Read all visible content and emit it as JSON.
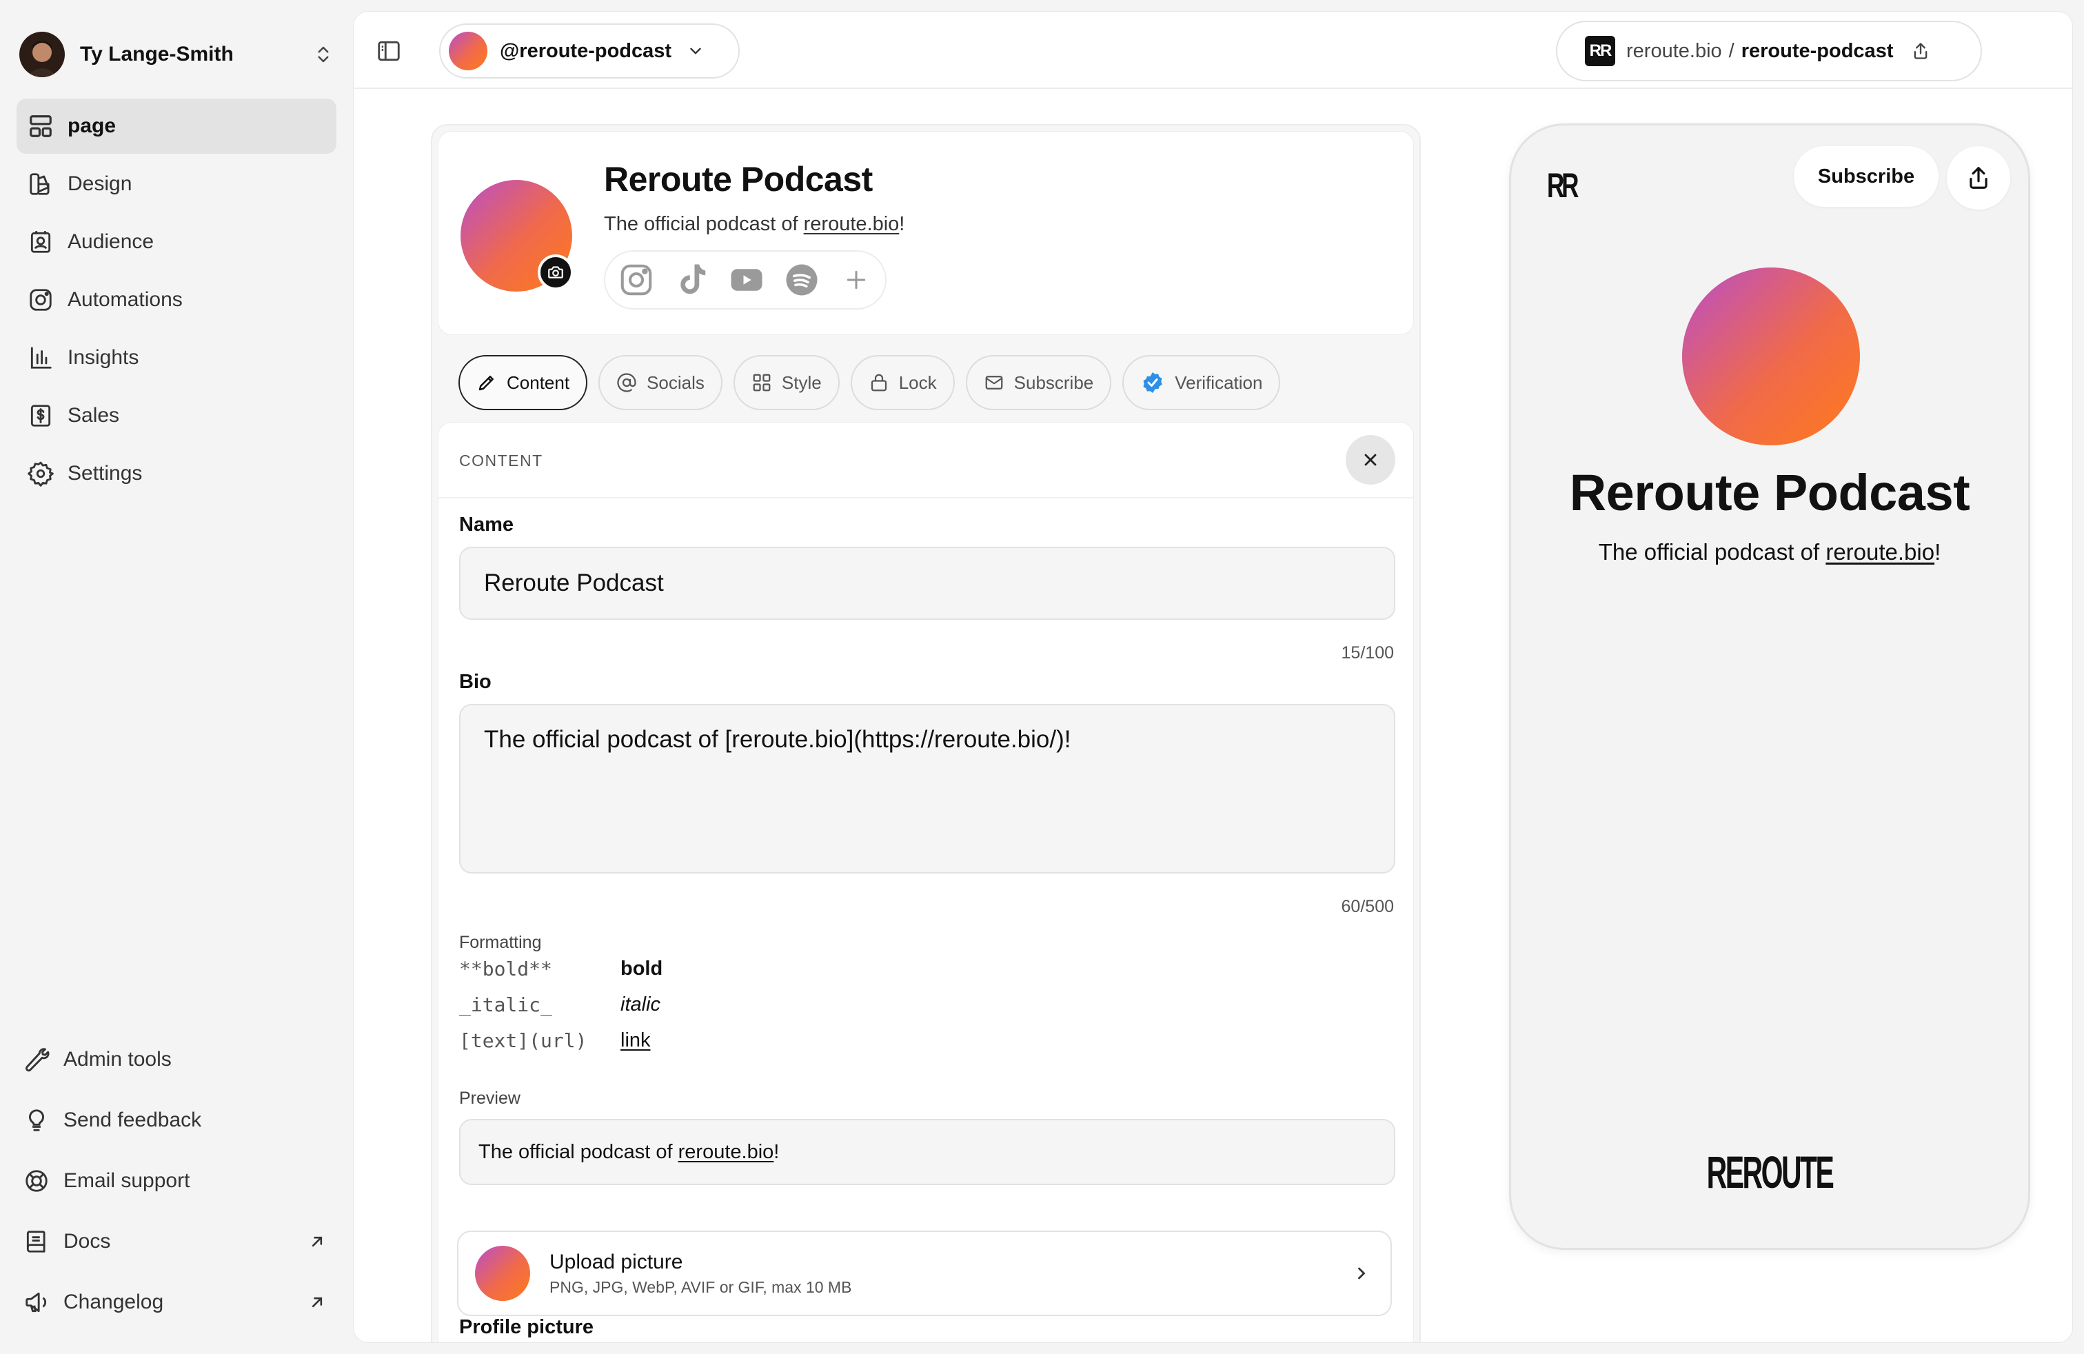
{
  "sidebar": {
    "user_name": "Ty Lange-Smith",
    "nav": [
      {
        "label": "page",
        "icon": "layout-icon",
        "active": true
      },
      {
        "label": "Design",
        "icon": "palette-icon"
      },
      {
        "label": "Audience",
        "icon": "contact-icon"
      },
      {
        "label": "Automations",
        "icon": "instagram-icon"
      },
      {
        "label": "Insights",
        "icon": "bar-chart-icon"
      },
      {
        "label": "Sales",
        "icon": "dollar-receipt-icon"
      },
      {
        "label": "Settings",
        "icon": "gear-icon"
      }
    ],
    "bottom": [
      {
        "label": "Admin tools",
        "icon": "wrench-icon"
      },
      {
        "label": "Send feedback",
        "icon": "lightbulb-icon"
      },
      {
        "label": "Email support",
        "icon": "lifebuoy-icon"
      },
      {
        "label": "Docs",
        "icon": "book-icon",
        "external": true
      },
      {
        "label": "Changelog",
        "icon": "megaphone-icon",
        "external": true
      }
    ]
  },
  "topbar": {
    "page_handle": "@reroute-podcast",
    "url_logo": "RR",
    "url_domain": "reroute.bio",
    "url_separator": "/",
    "url_slug": "reroute-podcast"
  },
  "profile": {
    "title": "Reroute Podcast",
    "bio_prefix": "The official podcast of ",
    "bio_link": "reroute.bio",
    "bio_suffix": "!",
    "socials": [
      "instagram-icon",
      "tiktok-icon",
      "youtube-icon",
      "spotify-icon"
    ]
  },
  "tabs": [
    "Content",
    "Socials",
    "Style",
    "Lock",
    "Subscribe",
    "Verification"
  ],
  "content": {
    "section_label": "CONTENT",
    "name_label": "Name",
    "name_value": "Reroute Podcast",
    "name_counter": "15/100",
    "bio_label": "Bio",
    "bio_value": "The official podcast of [reroute.bio](https://reroute.bio/)!",
    "bio_counter": "60/500",
    "formatting_label": "Formatting",
    "formatting": [
      {
        "code": "**bold**",
        "result": "bold"
      },
      {
        "code": "_italic_",
        "result": "italic"
      },
      {
        "code": "[text](url)",
        "result": "link"
      }
    ],
    "preview_label": "Preview",
    "preview_prefix": "The official podcast of ",
    "preview_link": "reroute.bio",
    "preview_suffix": "!",
    "picture_label": "Profile picture",
    "upload_title": "Upload picture",
    "upload_sub": "PNG, JPG, WebP, AVIF or GIF, max 10 MB"
  },
  "phone": {
    "logo": "RR",
    "subscribe_label": "Subscribe",
    "title": "Reroute Podcast",
    "bio_prefix": "The official podcast of ",
    "bio_link": "reroute.bio",
    "bio_suffix": "!",
    "footer": "REROUTE"
  },
  "colors": {
    "gradient_start": "#b94ec9",
    "gradient_end": "#ff7a1a",
    "verify_blue": "#2d8fe8"
  }
}
